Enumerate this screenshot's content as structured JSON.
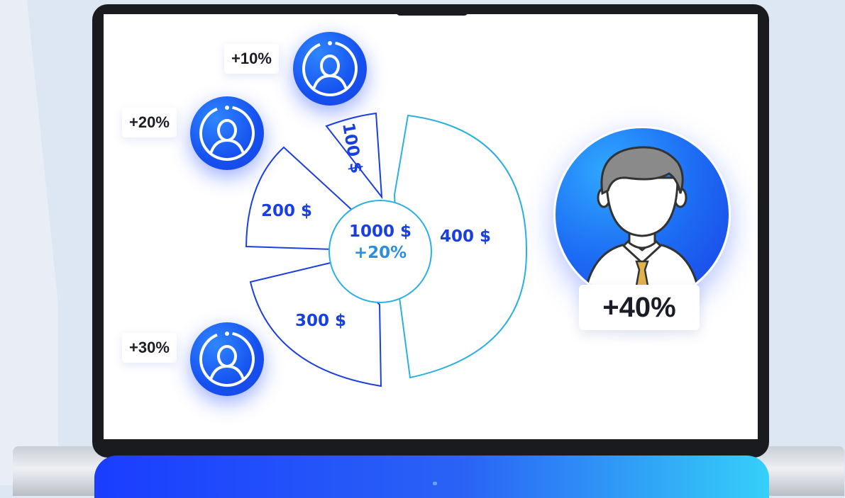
{
  "badges": {
    "top": "+10%",
    "middle": "+20%",
    "bottom": "+30%",
    "featured": "+40%"
  },
  "chart_data": {
    "type": "pie",
    "center": {
      "total": "1000 $",
      "percent": "+20%"
    },
    "slices": [
      {
        "label": "100 $",
        "value": 100
      },
      {
        "label": "200 $",
        "value": 200
      },
      {
        "label": "300 $",
        "value": 300
      },
      {
        "label": "400 $",
        "value": 400
      }
    ]
  },
  "colors": {
    "accent": "#1a3fe0",
    "accent_light": "#2bb0e0",
    "bar_start": "#1a3dff",
    "bar_end": "#35d0f8"
  },
  "icons": [
    "user-icon",
    "businessman-icon"
  ]
}
